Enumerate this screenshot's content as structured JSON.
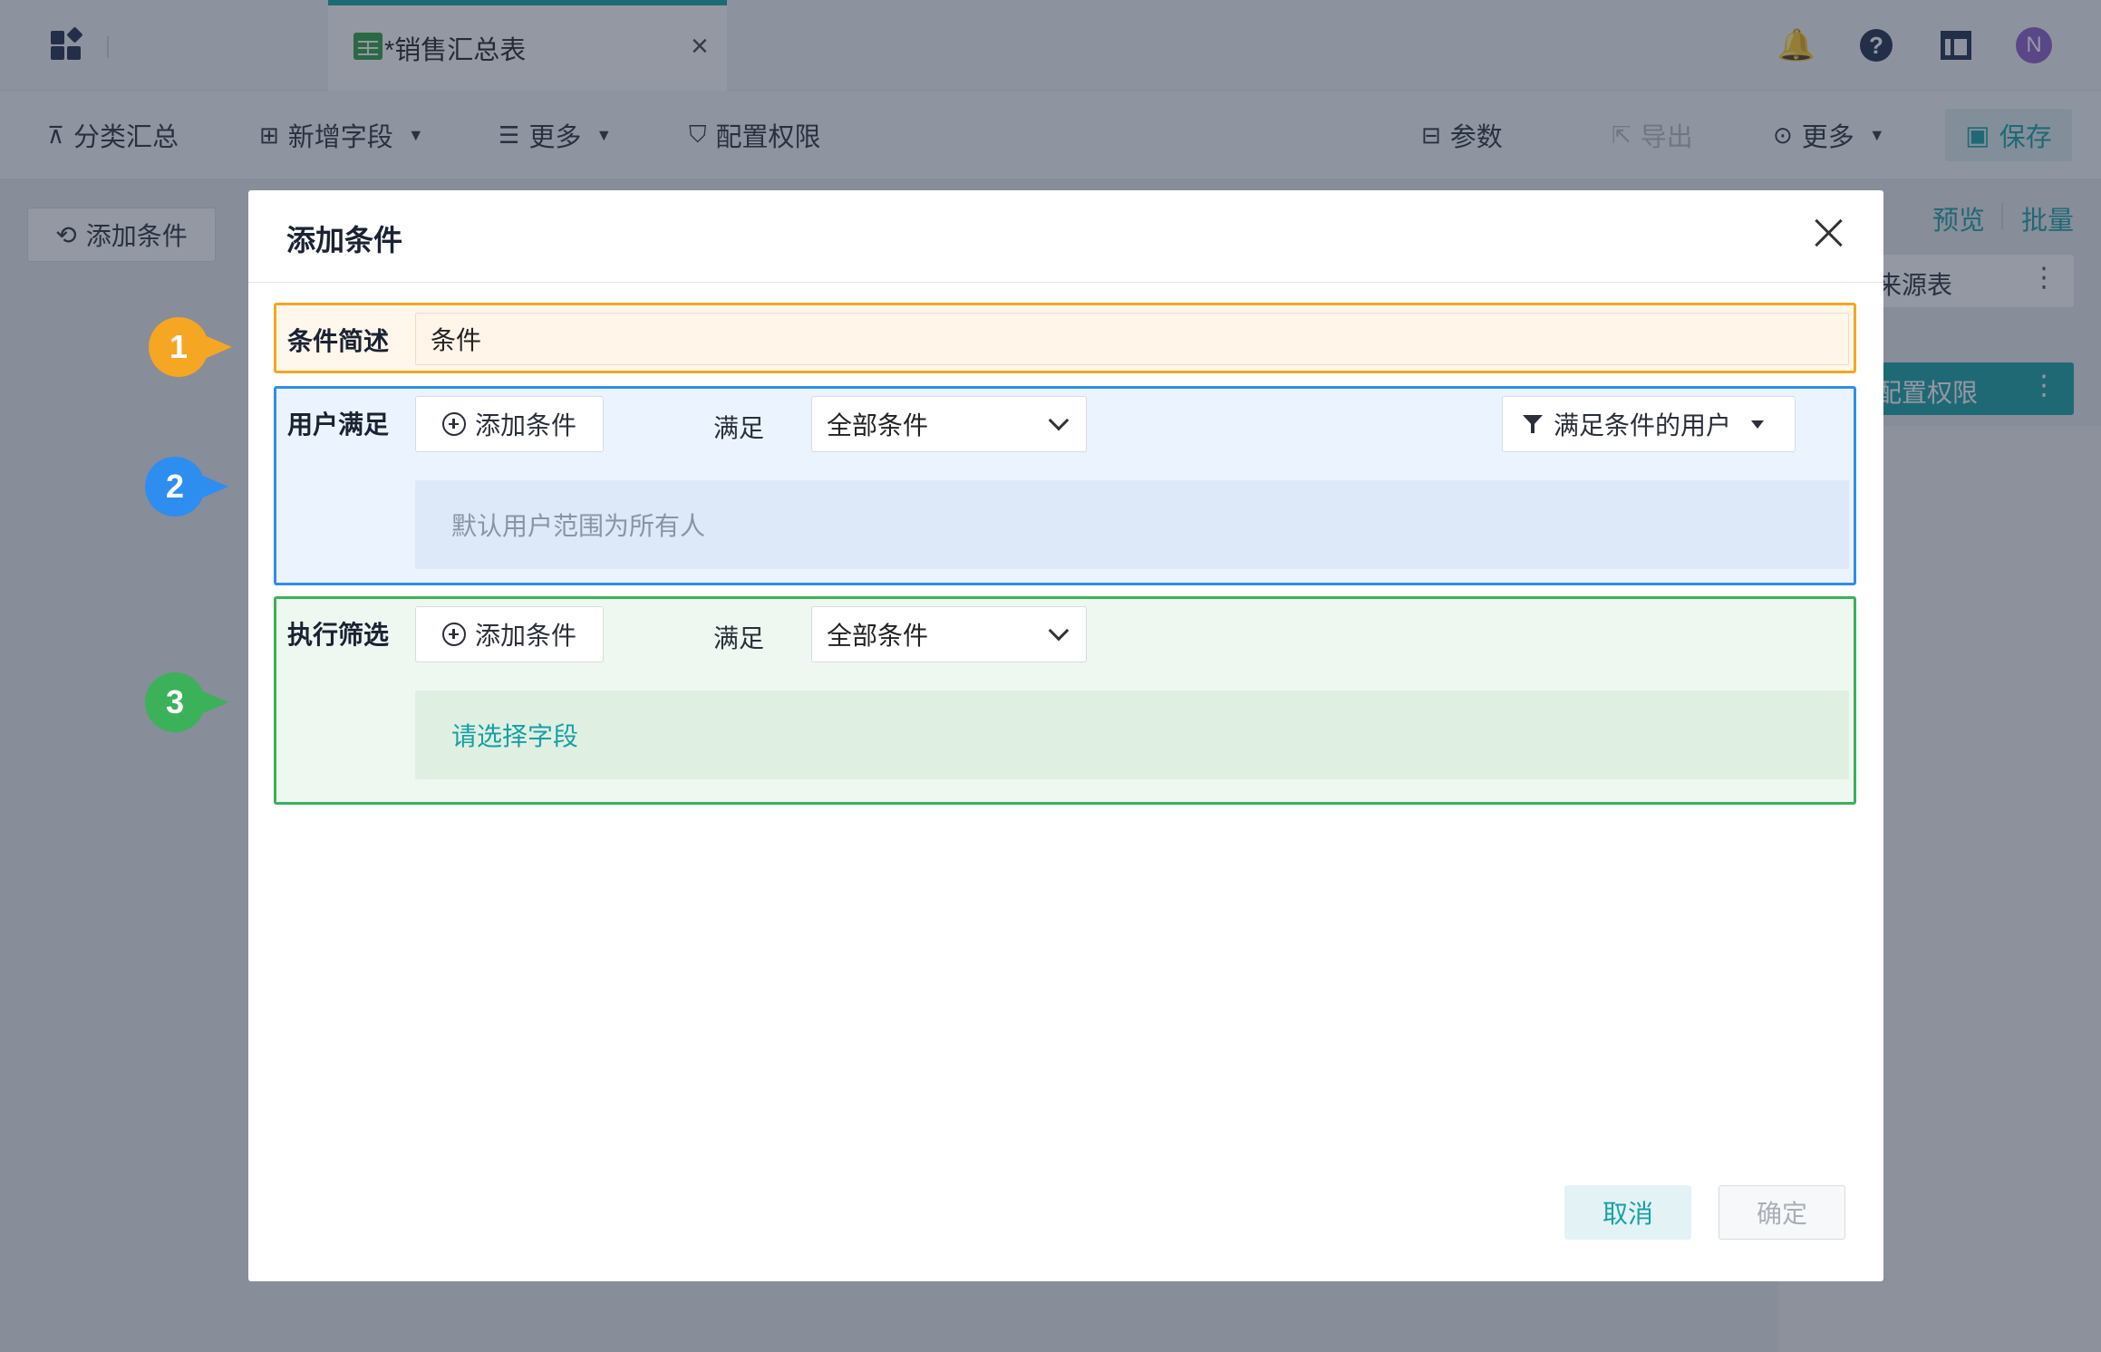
{
  "window": {
    "tab_title": "*销售汇总表"
  },
  "toolbar": {
    "group_summary": "分类汇总",
    "add_field": "新增字段",
    "more_left": "更多",
    "config_permission": "配置权限",
    "params": "参数",
    "export": "导出",
    "more_right": "更多",
    "save": "保存"
  },
  "background": {
    "add_condition": "添加条件",
    "preview": "预览",
    "batch": "批量",
    "source_table": "来源表",
    "config_permission_bar": "配置权限"
  },
  "user_avatar_initial": "N",
  "dialog": {
    "title": "添加条件",
    "description": {
      "label": "条件简述",
      "value": "条件"
    },
    "user_section": {
      "label": "用户满足",
      "add_condition": "添加条件",
      "meet": "满足",
      "match": "全部条件",
      "filter_users": "满足条件的用户",
      "empty_text": "默认用户范围为所有人"
    },
    "filter_section": {
      "label": "执行筛选",
      "add_condition": "添加条件",
      "meet": "满足",
      "match": "全部条件",
      "empty_text": "请选择字段"
    },
    "cancel": "取消",
    "confirm": "确定"
  },
  "markers": [
    "1",
    "2",
    "3"
  ],
  "colors": {
    "accent": "#17a0a5",
    "marker_1": "#f5a623",
    "marker_2": "#2e8ef0",
    "marker_3": "#3bb15a"
  }
}
